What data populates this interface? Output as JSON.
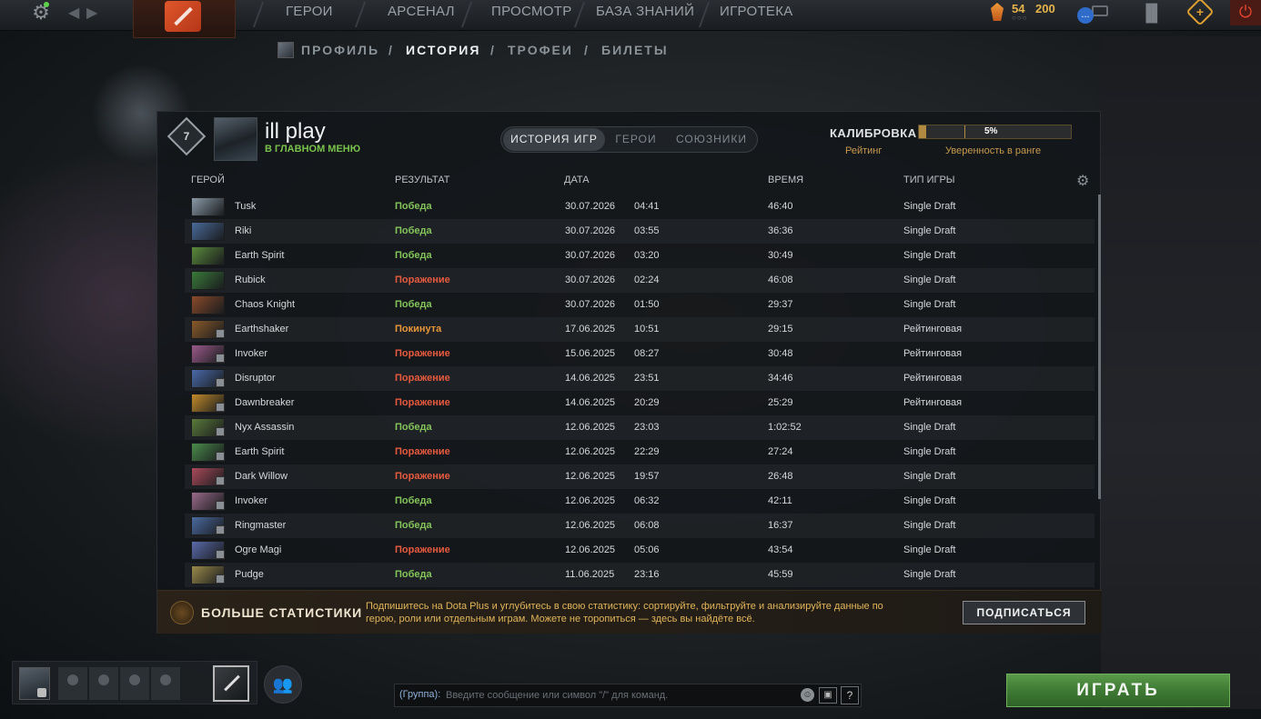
{
  "topbar": {
    "nav": [
      "ГЕРОИ",
      "АРСЕНАЛ",
      "ПРОСМОТР",
      "БАЗА ЗНАНИЙ",
      "ИГРОТЕКА"
    ],
    "shards_level": "54",
    "shards_count": "200",
    "chat_notice": "...",
    "power_icon": "power-icon",
    "settings_icon": "gear-icon"
  },
  "subnav": {
    "items": [
      "ПРОФИЛЬ",
      "ИСТОРИЯ",
      "ТРОФЕИ",
      "БИЛЕТЫ"
    ],
    "separator": "/",
    "active_index": 1
  },
  "profile": {
    "rank_number": "7",
    "name": "ill play",
    "status": "В ГЛАВНОМ МЕНЮ"
  },
  "tabs": [
    "ИСТОРИЯ ИГР",
    "ГЕРОИ",
    "СОЮЗНИКИ"
  ],
  "calibration": {
    "label": "КАЛИБРОВКА",
    "progress_percent": 5,
    "progress_label": "5%",
    "rating_label": "Рейтинг",
    "confidence_label": "Уверенность в ранге",
    "accent_color": "#b08a40"
  },
  "table": {
    "headers": [
      "ГЕРОЙ",
      "РЕЗУЛЬТАТ",
      "ДАТА",
      "ВРЕМЯ",
      "ТИП ИГРЫ"
    ],
    "rows": [
      {
        "hero": "Tusk",
        "result": "Победа",
        "date": "30.07.2026",
        "time": "04:41",
        "duration": "46:40",
        "mode": "Single Draft"
      },
      {
        "hero": "Riki",
        "result": "Победа",
        "date": "30.07.2026",
        "time": "03:55",
        "duration": "36:36",
        "mode": "Single Draft"
      },
      {
        "hero": "Earth Spirit",
        "result": "Победа",
        "date": "30.07.2026",
        "time": "03:20",
        "duration": "30:49",
        "mode": "Single Draft"
      },
      {
        "hero": "Rubick",
        "result": "Поражение",
        "date": "30.07.2026",
        "time": "02:24",
        "duration": "46:08",
        "mode": "Single Draft"
      },
      {
        "hero": "Chaos Knight",
        "result": "Победа",
        "date": "30.07.2026",
        "time": "01:50",
        "duration": "29:37",
        "mode": "Single Draft"
      },
      {
        "hero": "Earthshaker",
        "result": "Покинута",
        "date": "17.06.2025",
        "time": "10:51",
        "duration": "29:15",
        "mode": "Рейтинговая"
      },
      {
        "hero": "Invoker",
        "result": "Поражение",
        "date": "15.06.2025",
        "time": "08:27",
        "duration": "30:48",
        "mode": "Рейтинговая"
      },
      {
        "hero": "Disruptor",
        "result": "Поражение",
        "date": "14.06.2025",
        "time": "23:51",
        "duration": "34:46",
        "mode": "Рейтинговая"
      },
      {
        "hero": "Dawnbreaker",
        "result": "Поражение",
        "date": "14.06.2025",
        "time": "20:29",
        "duration": "25:29",
        "mode": "Рейтинговая"
      },
      {
        "hero": "Nyx Assassin",
        "result": "Победа",
        "date": "12.06.2025",
        "time": "23:03",
        "duration": "1:02:52",
        "mode": "Single Draft"
      },
      {
        "hero": "Earth Spirit",
        "result": "Поражение",
        "date": "12.06.2025",
        "time": "22:29",
        "duration": "27:24",
        "mode": "Single Draft"
      },
      {
        "hero": "Dark Willow",
        "result": "Поражение",
        "date": "12.06.2025",
        "time": "19:57",
        "duration": "26:48",
        "mode": "Single Draft"
      },
      {
        "hero": "Invoker",
        "result": "Победа",
        "date": "12.06.2025",
        "time": "06:32",
        "duration": "42:11",
        "mode": "Single Draft"
      },
      {
        "hero": "Ringmaster",
        "result": "Победа",
        "date": "12.06.2025",
        "time": "06:08",
        "duration": "16:37",
        "mode": "Single Draft"
      },
      {
        "hero": "Ogre Magi",
        "result": "Поражение",
        "date": "12.06.2025",
        "time": "05:06",
        "duration": "43:54",
        "mode": "Single Draft"
      },
      {
        "hero": "Pudge",
        "result": "Победа",
        "date": "11.06.2025",
        "time": "23:16",
        "duration": "45:59",
        "mode": "Single Draft"
      }
    ]
  },
  "promo": {
    "title": "БОЛЬШЕ СТАТИСТИКИ",
    "text": "Подпишитесь на Dota Plus и углубитесь в свою статистику: сортируйте, фильтруйте и анализируйте данные по герою, роли или отдельным играм. Можете не торопиться — здесь вы найдёте всё.",
    "button": "ПОДПИСАТЬСЯ"
  },
  "chat": {
    "channel": "(Группа):",
    "placeholder": "Введите сообщение или символ \"/\" для команд.",
    "help": "?"
  },
  "play_button": "ИГРАТЬ"
}
